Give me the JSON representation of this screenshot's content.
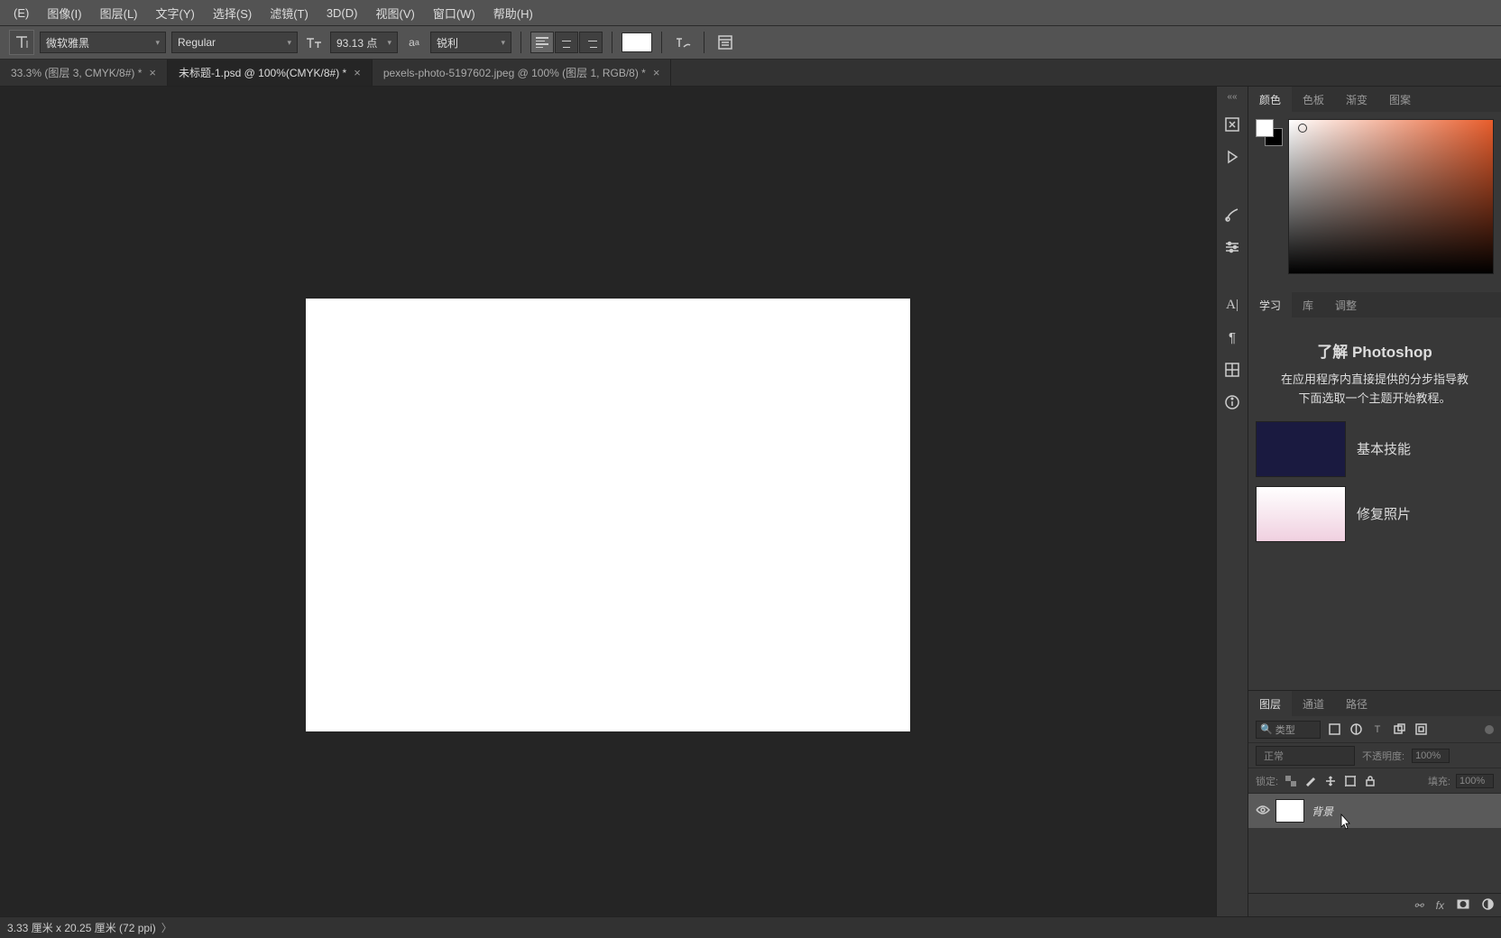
{
  "menubar": {
    "items": [
      "(E)",
      "图像(I)",
      "图层(L)",
      "文字(Y)",
      "选择(S)",
      "滤镜(T)",
      "3D(D)",
      "视图(V)",
      "窗口(W)",
      "帮助(H)"
    ]
  },
  "options": {
    "font_family": "微软雅黑",
    "font_style": "Regular",
    "font_size": "93.13 点",
    "aa_mode": "锐利"
  },
  "tabs": [
    {
      "label": "33.3% (图层 3, CMYK/8#) *",
      "active": false
    },
    {
      "label": "未标题-1.psd @ 100%(CMYK/8#) *",
      "active": true
    },
    {
      "label": "pexels-photo-5197602.jpeg @ 100% (图层 1, RGB/8) *",
      "active": false
    }
  ],
  "panels": {
    "color_tabs": [
      "颜色",
      "色板",
      "渐变",
      "图案"
    ],
    "learn_tabs": [
      "学习",
      "库",
      "调整"
    ],
    "learn": {
      "title": "了解 Photoshop",
      "desc_line1": "在应用程序内直接提供的分步指导教",
      "desc_line2": "下面选取一个主题开始教程。",
      "items": [
        "基本技能",
        "修复照片"
      ]
    },
    "layers_tabs": [
      "图层",
      "通道",
      "路径"
    ],
    "layers": {
      "filter_placeholder": "类型",
      "blend_mode": "正常",
      "opacity_label": "不透明度:",
      "opacity_value": "100%",
      "lock_label": "锁定:",
      "fill_label": "填充:",
      "fill_value": "100%",
      "layer_name": "背景"
    }
  },
  "statusbar": {
    "text": "3.33 厘米 x 20.25 厘米 (72 ppi)"
  }
}
